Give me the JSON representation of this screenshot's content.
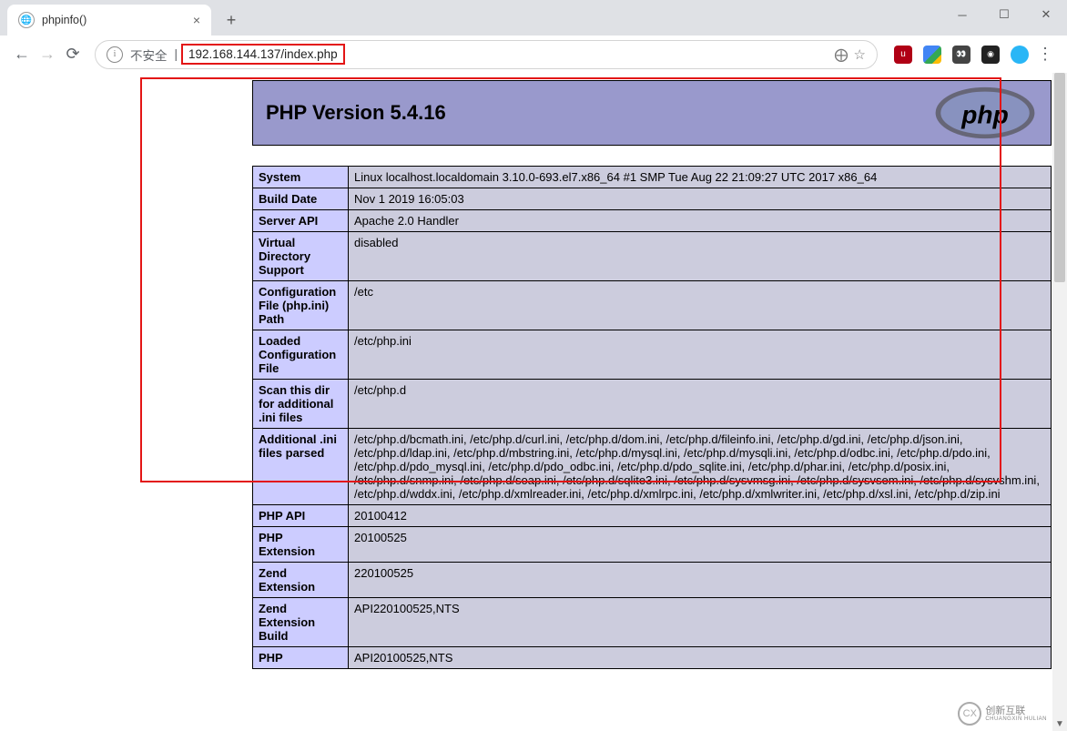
{
  "window": {
    "title": "phpinfo()"
  },
  "toolbar": {
    "not_secure": "不安全",
    "url": "192.168.144.137/index.php"
  },
  "php": {
    "header": "PHP Version 5.4.16",
    "rows": [
      {
        "k": "System",
        "v": "Linux localhost.localdomain 3.10.0-693.el7.x86_64 #1 SMP Tue Aug 22 21:09:27 UTC 2017 x86_64"
      },
      {
        "k": "Build Date",
        "v": "Nov 1 2019 16:05:03"
      },
      {
        "k": "Server API",
        "v": "Apache 2.0 Handler"
      },
      {
        "k": "Virtual Directory Support",
        "v": "disabled"
      },
      {
        "k": "Configuration File (php.ini) Path",
        "v": "/etc"
      },
      {
        "k": "Loaded Configuration File",
        "v": "/etc/php.ini"
      },
      {
        "k": "Scan this dir for additional .ini files",
        "v": "/etc/php.d"
      },
      {
        "k": "Additional .ini files parsed",
        "v": "/etc/php.d/bcmath.ini, /etc/php.d/curl.ini, /etc/php.d/dom.ini, /etc/php.d/fileinfo.ini, /etc/php.d/gd.ini, /etc/php.d/json.ini, /etc/php.d/ldap.ini, /etc/php.d/mbstring.ini, /etc/php.d/mysql.ini, /etc/php.d/mysqli.ini, /etc/php.d/odbc.ini, /etc/php.d/pdo.ini, /etc/php.d/pdo_mysql.ini, /etc/php.d/pdo_odbc.ini, /etc/php.d/pdo_sqlite.ini, /etc/php.d/phar.ini, /etc/php.d/posix.ini, /etc/php.d/snmp.ini, /etc/php.d/soap.ini, /etc/php.d/sqlite3.ini, /etc/php.d/sysvmsg.ini, /etc/php.d/sysvsem.ini, /etc/php.d/sysvshm.ini, /etc/php.d/wddx.ini, /etc/php.d/xmlreader.ini, /etc/php.d/xmlrpc.ini, /etc/php.d/xmlwriter.ini, /etc/php.d/xsl.ini, /etc/php.d/zip.ini"
      },
      {
        "k": "PHP API",
        "v": "20100412"
      },
      {
        "k": "PHP Extension",
        "v": "20100525"
      },
      {
        "k": "Zend Extension",
        "v": "220100525"
      },
      {
        "k": "Zend Extension Build",
        "v": "API220100525,NTS"
      },
      {
        "k": "PHP",
        "v": "API20100525,NTS"
      }
    ]
  },
  "watermark": {
    "text": "创新互联",
    "sub": "CHUANGXIN HULIAN"
  }
}
